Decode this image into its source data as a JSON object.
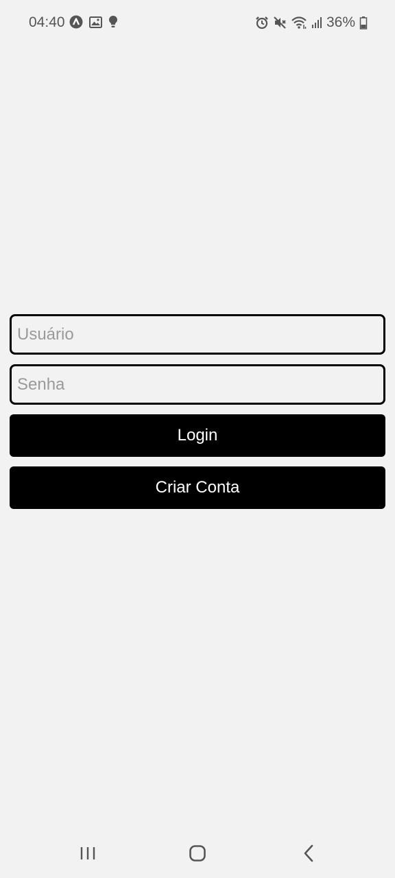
{
  "status_bar": {
    "time": "04:40",
    "battery_percent": "36%",
    "left_icons": [
      "nav-app-icon",
      "gallery-icon",
      "bulb-icon"
    ],
    "right_icons": [
      "alarm-icon",
      "mute-icon",
      "wifi-icon",
      "signal-icon",
      "battery-icon"
    ],
    "battery_level": 0.36
  },
  "login_form": {
    "username_placeholder": "Usuário",
    "password_placeholder": "Senha",
    "login_label": "Login",
    "create_account_label": "Criar Conta"
  },
  "nav_bar": {
    "icons": [
      "recents-icon",
      "home-icon",
      "back-icon"
    ]
  },
  "colors": {
    "background": "#f2f2f2",
    "button": "#000000",
    "button_text": "#ffffff",
    "placeholder": "#9a9a9a"
  }
}
